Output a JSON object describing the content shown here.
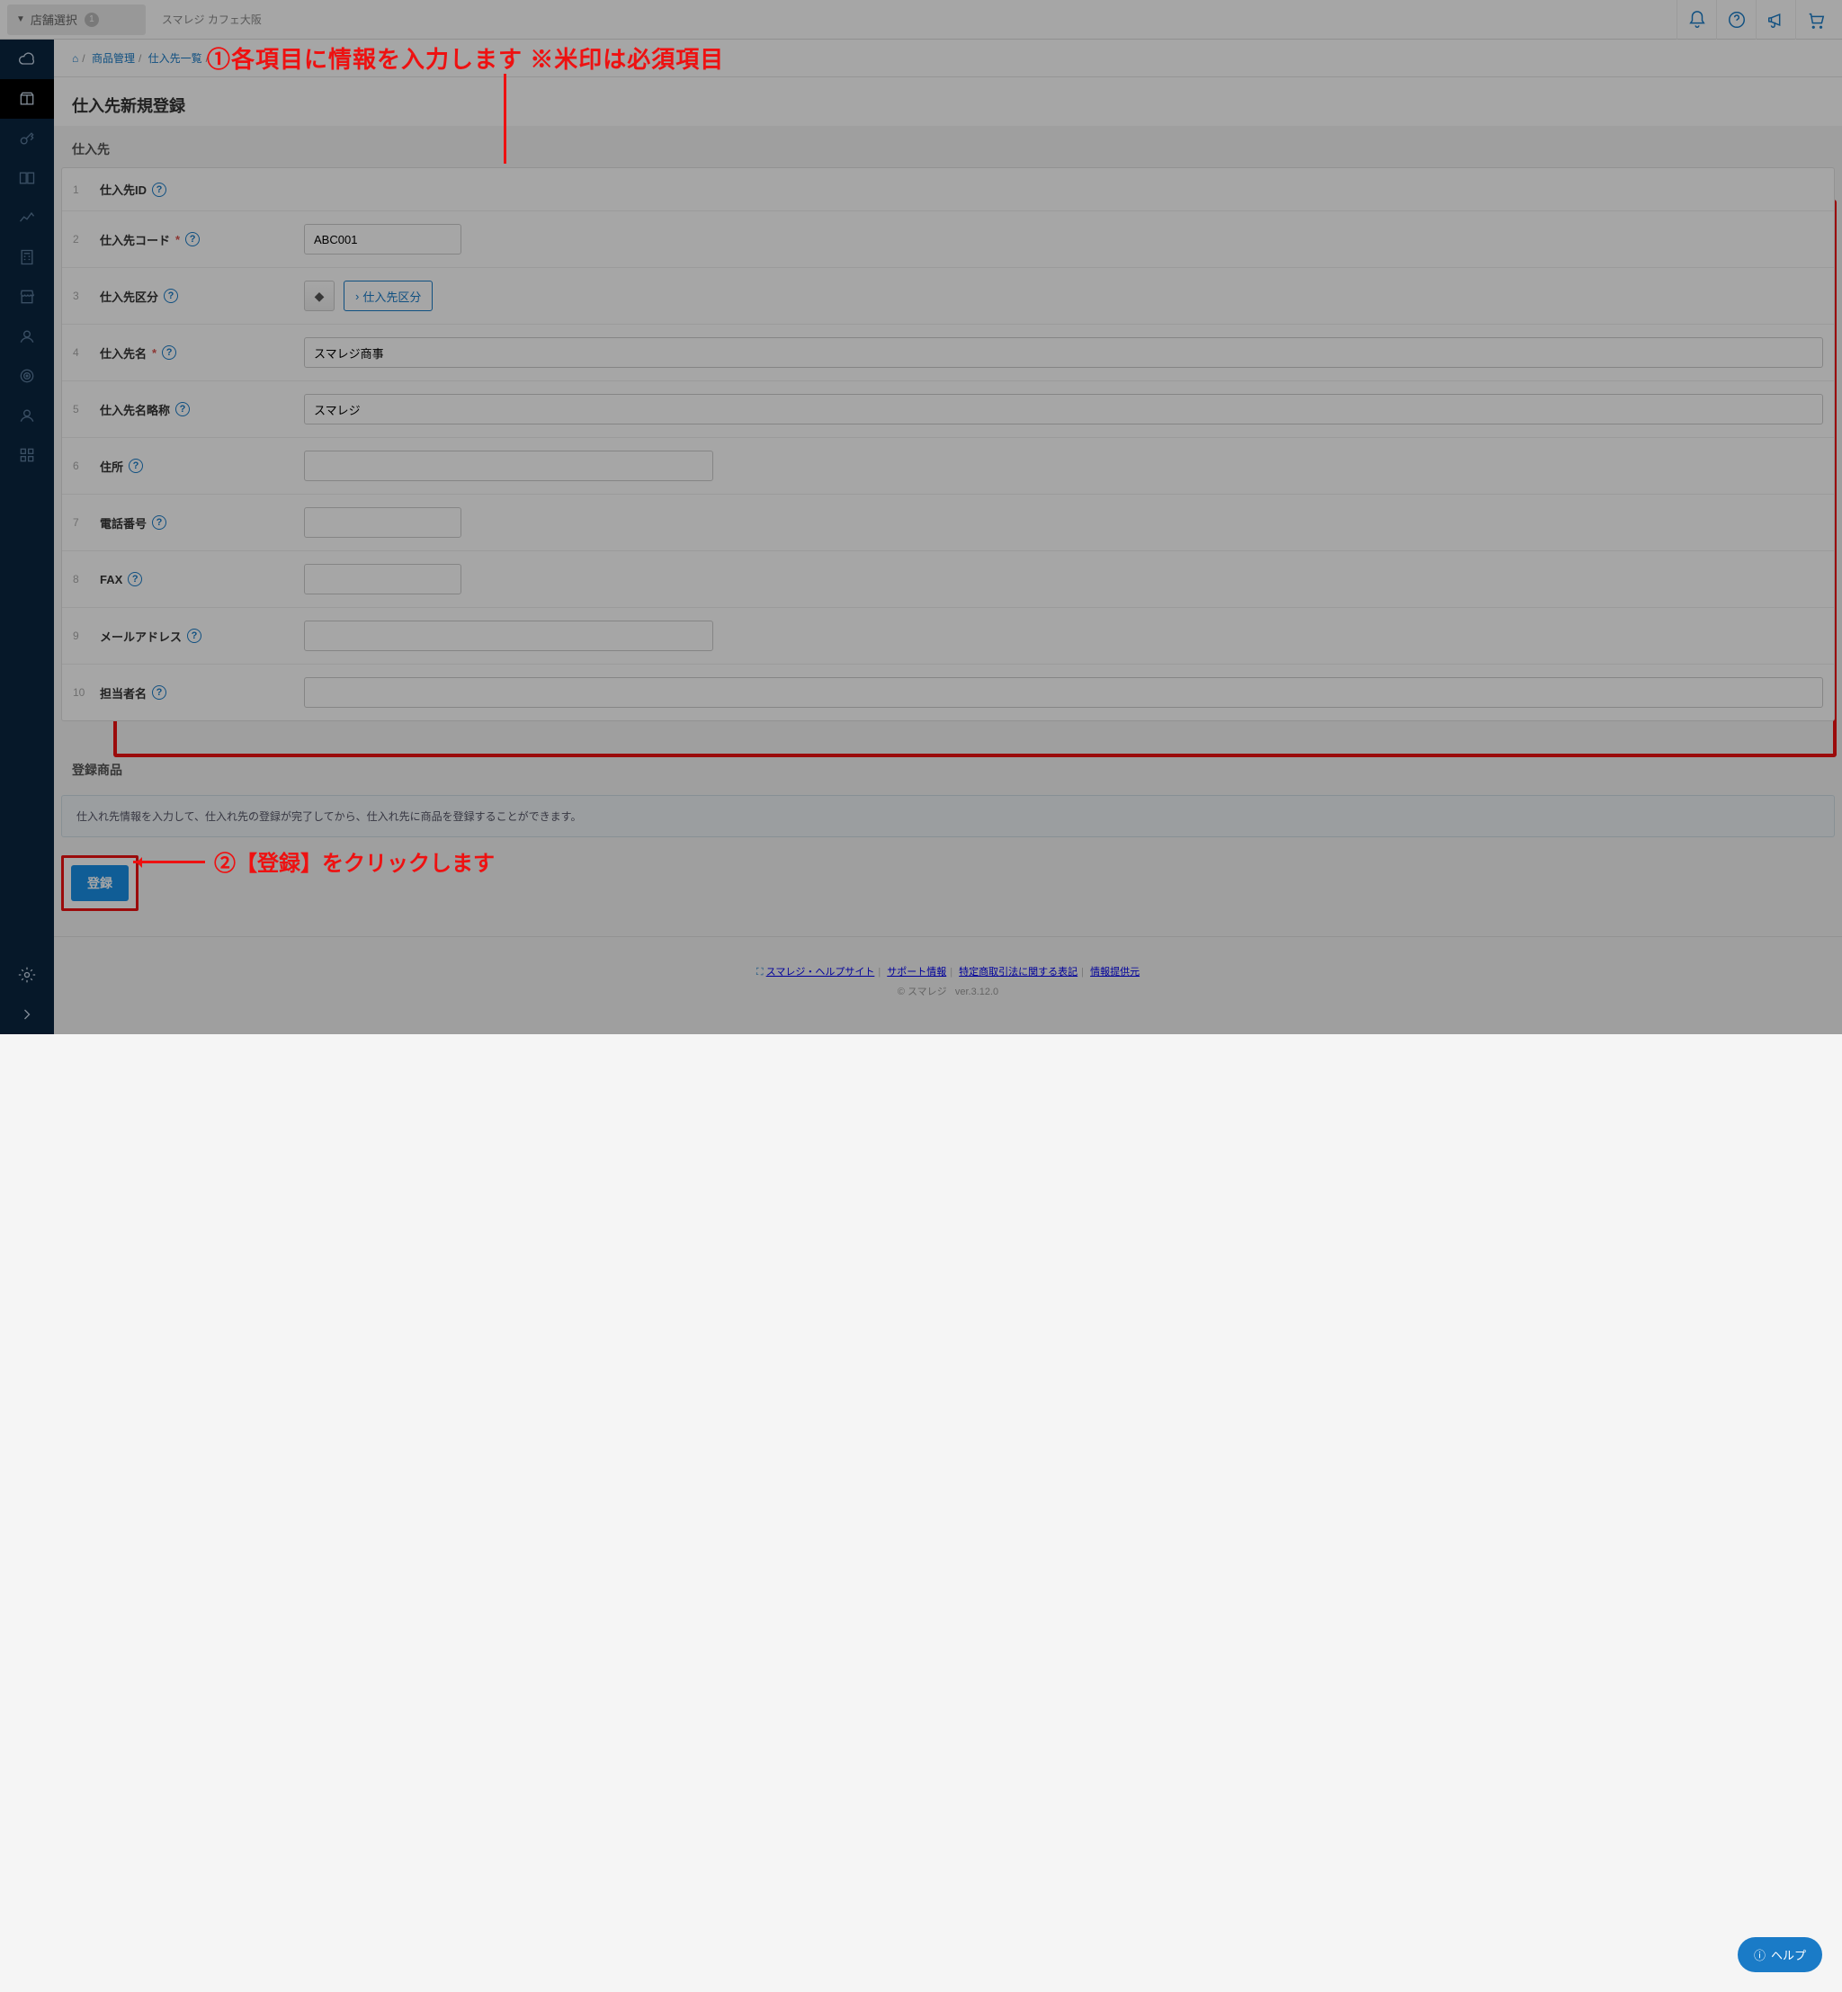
{
  "topbar": {
    "store_select_label": "店舗選択",
    "store_badge": "1",
    "store_name": "スマレジ カフェ大阪"
  },
  "breadcrumb": {
    "item1": "商品管理",
    "item2": "仕入先一覧"
  },
  "page_title": "仕入先新規登録",
  "section1_title": "仕入先",
  "rows": {
    "r1": {
      "no": "1",
      "label": "仕入先ID"
    },
    "r2": {
      "no": "2",
      "label": "仕入先コード",
      "value": "ABC001"
    },
    "r3": {
      "no": "3",
      "label": "仕入先区分",
      "btn": "仕入先区分"
    },
    "r4": {
      "no": "4",
      "label": "仕入先名",
      "value": "スマレジ商事"
    },
    "r5": {
      "no": "5",
      "label": "仕入先名略称",
      "value": "スマレジ"
    },
    "r6": {
      "no": "6",
      "label": "住所",
      "value": ""
    },
    "r7": {
      "no": "7",
      "label": "電話番号",
      "value": ""
    },
    "r8": {
      "no": "8",
      "label": "FAX",
      "value": ""
    },
    "r9": {
      "no": "9",
      "label": "メールアドレス",
      "value": ""
    },
    "r10": {
      "no": "10",
      "label": "担当者名",
      "value": ""
    }
  },
  "section2_title": "登録商品",
  "info_text": "仕入れ先情報を入力して、仕入れ先の登録が完了してから、仕入れ先に商品を登録することができます。",
  "submit_label": "登録",
  "footer": {
    "l1": "スマレジ・ヘルプサイト",
    "l2": "サポート情報",
    "l3": "特定商取引法に関する表記",
    "l4": "情報提供元",
    "copy": "© スマレジ",
    "ver": "ver.3.12.0"
  },
  "help_fab": "ヘルプ",
  "anno1": "①各項目に情報を入力します ※米印は必須項目",
  "anno2": "②【登録】をクリックします"
}
